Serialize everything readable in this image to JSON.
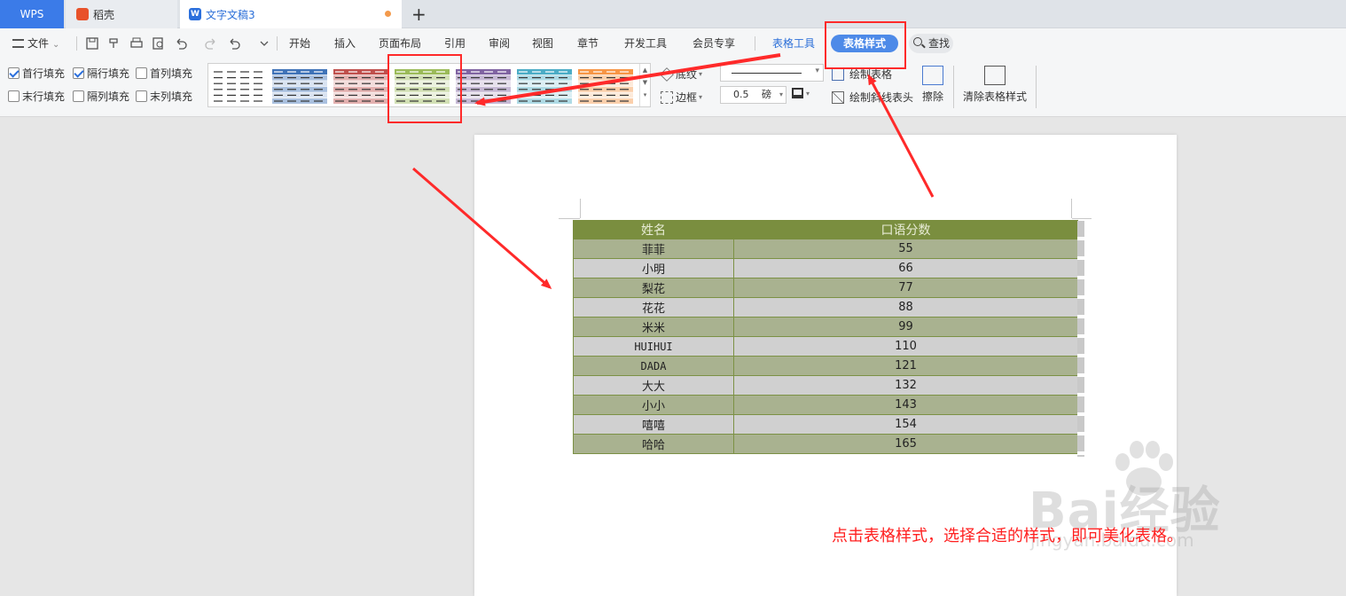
{
  "tabs": {
    "wps": "WPS",
    "daoke": "稻壳",
    "doc": "文字文稿3",
    "new_tab": "+"
  },
  "menu": {
    "file": "文件",
    "items": [
      "开始",
      "插入",
      "页面布局",
      "引用",
      "审阅",
      "视图",
      "章节",
      "开发工具",
      "会员专享",
      "表格工具",
      "表格样式"
    ],
    "search": "查找"
  },
  "ribbon": {
    "checkboxes": [
      {
        "label": "首行填充",
        "checked": true
      },
      {
        "label": "隔行填充",
        "checked": true
      },
      {
        "label": "首列填充",
        "checked": false
      },
      {
        "label": "末行填充",
        "checked": false
      },
      {
        "label": "隔列填充",
        "checked": false
      },
      {
        "label": "末列填充",
        "checked": false
      }
    ],
    "shading": "底纹",
    "border": "边框",
    "line_width": "0.5",
    "line_unit": "磅",
    "draw_table": "绘制表格",
    "draw_diagonal": "绘制斜线表头",
    "erase": "擦除",
    "clear_style": "清除表格样式",
    "style_colors": [
      "#ffffff",
      "#3f73b8",
      "#c0504d",
      "#9bbb59",
      "#8064a2",
      "#4bacc6",
      "#f79646"
    ]
  },
  "table": {
    "headers": [
      "姓名",
      "口语分数"
    ],
    "rows": [
      [
        "菲菲",
        "55"
      ],
      [
        "小明",
        "66"
      ],
      [
        "梨花",
        "77"
      ],
      [
        "花花",
        "88"
      ],
      [
        "米米",
        "99"
      ],
      [
        "HUIHUI",
        "110"
      ],
      [
        "DADA",
        "121"
      ],
      [
        "大大",
        "132"
      ],
      [
        "小小",
        "143"
      ],
      [
        "嘻嘻",
        "154"
      ],
      [
        "哈哈",
        "165"
      ]
    ],
    "header_color": "#7a8e3f",
    "band_color": "#a9b290"
  },
  "annotation": {
    "text": "点击表格样式，选择合适的样式，即可美化表格。",
    "color": "#ff2020"
  },
  "watermark": {
    "brand": "Bai经验",
    "url": "jingyan.baidu.com"
  }
}
